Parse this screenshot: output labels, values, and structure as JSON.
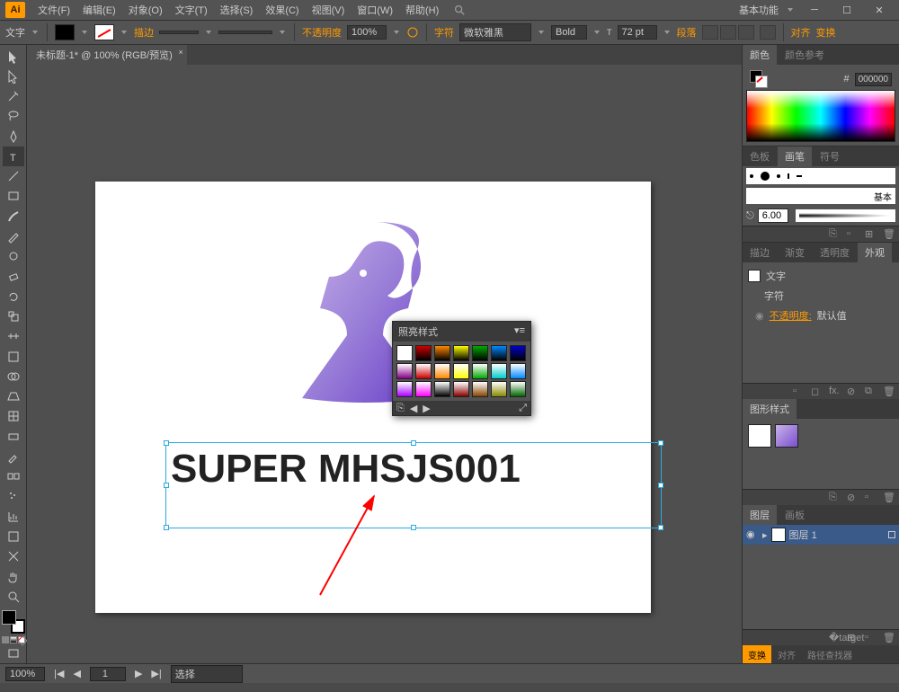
{
  "app": {
    "logo": "Ai",
    "workspace": "基本功能"
  },
  "menu": [
    "文件(F)",
    "编辑(E)",
    "对象(O)",
    "文字(T)",
    "选择(S)",
    "效果(C)",
    "视图(V)",
    "窗口(W)",
    "帮助(H)"
  ],
  "optbar": {
    "tool": "文字",
    "stroke_label": "描边",
    "stroke_pt": "",
    "opacity_label": "不透明度",
    "opacity": "100%",
    "char_label": "字符",
    "font": "微软雅黑",
    "weight": "Bold",
    "size": "72 pt",
    "para_label": "段落",
    "align_label": "对齐",
    "transform_label": "变换"
  },
  "tab": {
    "name": "未标题-1* @ 100% (RGB/预览)"
  },
  "canvas": {
    "text": "SUPER MHSJS001"
  },
  "float_panel": {
    "title": "照亮样式"
  },
  "panels": {
    "color": {
      "tab1": "颜色",
      "tab2": "颜色参考",
      "hex": "000000"
    },
    "swatches": {
      "tab1": "色板",
      "tab2": "画笔",
      "tab3": "符号",
      "basic": "基本",
      "size": "6.00"
    },
    "appearance": {
      "tab1": "描边",
      "tab2": "渐变",
      "tab3": "透明度",
      "tab4": "外观",
      "obj": "文字",
      "char": "字符",
      "op_label": "不透明度:",
      "op_val": "默认值"
    },
    "gstyle": {
      "tab": "图形样式"
    },
    "layers": {
      "tab1": "图层",
      "tab2": "画板",
      "name": "图层 1"
    },
    "bottom": {
      "tab1": "变换",
      "tab2": "对齐",
      "tab3": "路径查找器"
    }
  },
  "status": {
    "zoom": "100%",
    "nav": "1",
    "sel": "选择"
  },
  "swatch_colors": [
    "#fff",
    "#c00",
    "#f80",
    "#ff0",
    "#0a0",
    "#08f",
    "#00c",
    "#808",
    "#c00",
    "#f80",
    "#ff0",
    "#0a0",
    "#0cc",
    "#08f",
    "#a0f",
    "#f0f",
    "#000",
    "#800",
    "#840",
    "#880",
    "#060",
    "#066"
  ],
  "gstyles": [
    "#ffffff",
    "linear-gradient(135deg,#b9a0e8,#8a5fd0)"
  ]
}
